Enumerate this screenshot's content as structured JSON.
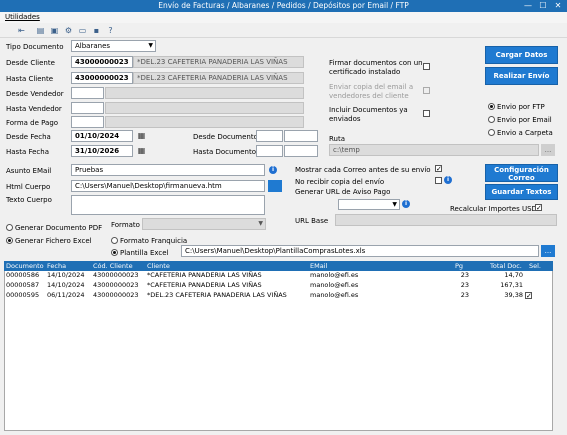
{
  "window": {
    "title": "Envío de Facturas / Albaranes / Pedidos / Depósitos por Email / FTP",
    "minimize": "—",
    "maximize": "☐",
    "close": "✕"
  },
  "menu": [
    "Utilidades"
  ],
  "toolbar": {
    "icons": [
      "exit-icon",
      "print-icon",
      "preview-icon",
      "settings-icon",
      "open-folder-icon",
      "save-icon",
      "help-icon"
    ]
  },
  "form": {
    "tipo_documento": {
      "label": "Tipo Documento",
      "value": "Albaranes"
    },
    "desde_cliente": {
      "label": "Desde Cliente",
      "code": "43000000023",
      "name": "*DEL.23 CAFETERIA PANADERIA LAS VIÑAS"
    },
    "hasta_cliente": {
      "label": "Hasta Cliente",
      "code": "43000000023",
      "name": "*DEL.23 CAFETERIA PANADERIA LAS VIÑAS"
    },
    "desde_vendedor": {
      "label": "Desde Vendedor"
    },
    "hasta_vendedor": {
      "label": "Hasta Vendedor"
    },
    "forma_pago": {
      "label": "Forma de Pago"
    },
    "desde_fecha": {
      "label": "Desde Fecha",
      "value": "01/10/2024"
    },
    "hasta_fecha": {
      "label": "Hasta Fecha",
      "value": "31/10/2026"
    },
    "desde_documento": {
      "label": "Desde Documento"
    },
    "hasta_documento": {
      "label": "Hasta Documento"
    },
    "firmar": {
      "label1": "Firmar documentos con un",
      "label2": "certificado instalado"
    },
    "enviar_copia": {
      "label1": "Enviar copia del email a",
      "label2": "vendedores del cliente"
    },
    "incluir_enviados": {
      "label1": "Incluir Documentos ya",
      "label2": "enviados"
    },
    "envio_options": [
      "Envio por FTP",
      "Envio por Email",
      "Envio a Carpeta"
    ],
    "ruta": {
      "label": "Ruta",
      "value": "c:\\temp"
    },
    "asunto": {
      "label": "Asunto EMail",
      "value": "Pruebas"
    },
    "html_cuerpo": {
      "label": "Html Cuerpo",
      "value": "C:\\Users\\Manuel\\Desktop\\firmanueva.htm"
    },
    "texto_cuerpo": {
      "label": "Texto Cuerpo"
    },
    "mostrar_correo": {
      "label": "Mostrar cada Correo antes de su envío"
    },
    "no_recibir_copia": {
      "label": "No recibir copia del envío"
    },
    "generar_url": {
      "label": "Generar URL de  Aviso Pago"
    },
    "url_base": {
      "label": "URL Base"
    },
    "recalcular": {
      "label": "Recalcular Importes USD"
    },
    "generar_pdf": {
      "label": "Generar Documento PDF"
    },
    "formato": {
      "label": "Formato"
    },
    "generar_excel": {
      "label": "Generar Fichero Excel"
    },
    "formato_franquicia": {
      "label": "Formato Franquicia"
    },
    "plantilla_excel": {
      "label": "Plantilla Excel",
      "value": "C:\\Users\\Manuel\\Desktop\\PlantillaComprasLotes.xls"
    }
  },
  "buttons": {
    "cargar": "Cargar Datos",
    "realizar": "Realizar Envío",
    "config_l1": "Configuración",
    "config_l2": "Correo",
    "guardar": "Guardar Textos"
  },
  "grid": {
    "columns": [
      "Documento",
      "Fecha",
      "Cód. Cliente",
      "Cliente",
      "EMail",
      "Pg",
      "Total Doc.",
      "Sel."
    ],
    "rows": [
      [
        "00000586",
        "14/10/2024",
        "43000000023",
        "*CAFETERIA PANADERIA LAS VIÑAS",
        "manolo@efi.es",
        "23",
        "14,70",
        ""
      ],
      [
        "00000587",
        "14/10/2024",
        "43000000023",
        "*CAFETERIA PANADERIA LAS VIÑAS",
        "manolo@efi.es",
        "23",
        "167,31",
        ""
      ],
      [
        "00000595",
        "06/11/2024",
        "43000000023",
        "*DEL.23 CAFETERIA PANADERIA LAS VIÑAS",
        "manolo@efi.es",
        "23",
        "39,38",
        "✓"
      ]
    ]
  },
  "colors": {
    "accent": "#1f7ad1",
    "titlebar": "#1f6fb5"
  }
}
